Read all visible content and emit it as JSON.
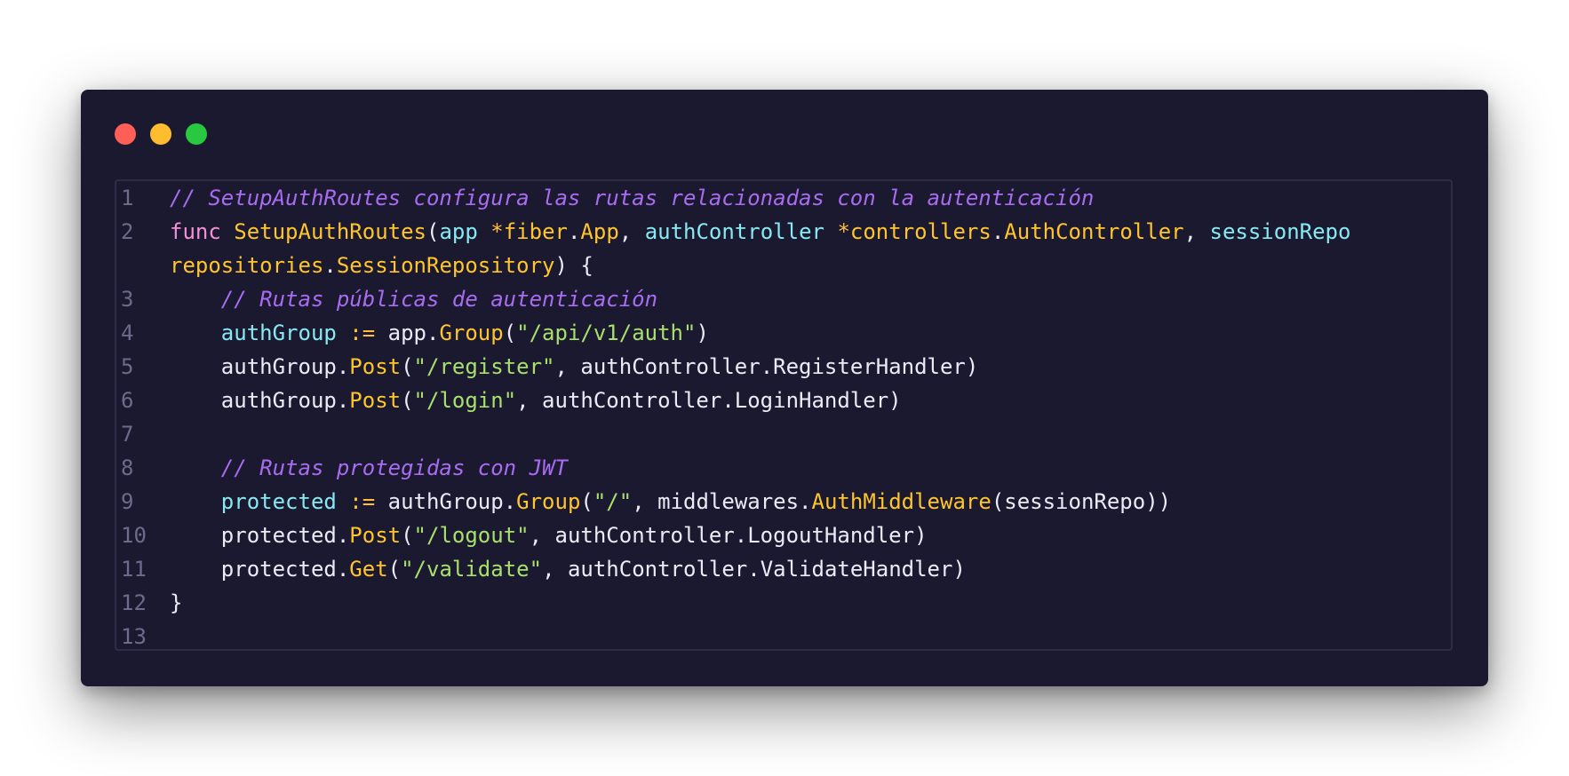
{
  "colors": {
    "window_bg": "#1b1930",
    "comment": "#a86cf0",
    "keyword": "#f48fd8",
    "function": "#ffc52b",
    "variable": "#87eaf2",
    "operator": "#ffbe3c",
    "string": "#a8e06b",
    "text": "#ecebf5",
    "line_number": "#6d6a8c"
  },
  "window_controls": [
    "close",
    "minimize",
    "maximize"
  ],
  "code": {
    "lines": [
      {
        "num": "1",
        "tokens": [
          {
            "t": "cmt",
            "v": "// SetupAuthRoutes configura las rutas relacionadas con la autenticación"
          }
        ]
      },
      {
        "num": "2",
        "tokens": [
          {
            "t": "kw",
            "v": "func"
          },
          {
            "t": "pl",
            "v": " "
          },
          {
            "t": "fn",
            "v": "SetupAuthRoutes"
          },
          {
            "t": "pl",
            "v": "("
          },
          {
            "t": "var",
            "v": "app"
          },
          {
            "t": "pl",
            "v": " "
          },
          {
            "t": "op",
            "v": "*"
          },
          {
            "t": "fn",
            "v": "fiber"
          },
          {
            "t": "pl",
            "v": "."
          },
          {
            "t": "fn",
            "v": "App"
          },
          {
            "t": "pl",
            "v": ", "
          },
          {
            "t": "var",
            "v": "authController"
          },
          {
            "t": "pl",
            "v": " "
          },
          {
            "t": "op",
            "v": "*"
          },
          {
            "t": "fn",
            "v": "controllers"
          },
          {
            "t": "pl",
            "v": "."
          },
          {
            "t": "fn",
            "v": "AuthController"
          },
          {
            "t": "pl",
            "v": ", "
          },
          {
            "t": "var",
            "v": "sessionRepo"
          }
        ]
      },
      {
        "num": "",
        "tokens": [
          {
            "t": "fn",
            "v": "repositories"
          },
          {
            "t": "pl",
            "v": "."
          },
          {
            "t": "fn",
            "v": "SessionRepository"
          },
          {
            "t": "pl",
            "v": ") {"
          }
        ]
      },
      {
        "num": "3",
        "tokens": [
          {
            "t": "pl",
            "v": "    "
          },
          {
            "t": "cmt",
            "v": "// Rutas públicas de autenticación"
          }
        ]
      },
      {
        "num": "4",
        "tokens": [
          {
            "t": "pl",
            "v": "    "
          },
          {
            "t": "var",
            "v": "authGroup"
          },
          {
            "t": "pl",
            "v": " "
          },
          {
            "t": "op",
            "v": ":="
          },
          {
            "t": "pl",
            "v": " app."
          },
          {
            "t": "fn",
            "v": "Group"
          },
          {
            "t": "pl",
            "v": "("
          },
          {
            "t": "str",
            "v": "\"/api/v1/auth\""
          },
          {
            "t": "pl",
            "v": ")"
          }
        ]
      },
      {
        "num": "5",
        "tokens": [
          {
            "t": "pl",
            "v": "    authGroup."
          },
          {
            "t": "fn",
            "v": "Post"
          },
          {
            "t": "pl",
            "v": "("
          },
          {
            "t": "str",
            "v": "\"/register\""
          },
          {
            "t": "pl",
            "v": ", authController.RegisterHandler)"
          }
        ]
      },
      {
        "num": "6",
        "tokens": [
          {
            "t": "pl",
            "v": "    authGroup."
          },
          {
            "t": "fn",
            "v": "Post"
          },
          {
            "t": "pl",
            "v": "("
          },
          {
            "t": "str",
            "v": "\"/login\""
          },
          {
            "t": "pl",
            "v": ", authController.LoginHandler)"
          }
        ]
      },
      {
        "num": "7",
        "tokens": []
      },
      {
        "num": "8",
        "tokens": [
          {
            "t": "pl",
            "v": "    "
          },
          {
            "t": "cmt",
            "v": "// Rutas protegidas con JWT"
          }
        ]
      },
      {
        "num": "9",
        "tokens": [
          {
            "t": "pl",
            "v": "    "
          },
          {
            "t": "var",
            "v": "protected"
          },
          {
            "t": "pl",
            "v": " "
          },
          {
            "t": "op",
            "v": ":="
          },
          {
            "t": "pl",
            "v": " authGroup."
          },
          {
            "t": "fn",
            "v": "Group"
          },
          {
            "t": "pl",
            "v": "("
          },
          {
            "t": "str",
            "v": "\"/\""
          },
          {
            "t": "pl",
            "v": ", middlewares."
          },
          {
            "t": "fn",
            "v": "AuthMiddleware"
          },
          {
            "t": "pl",
            "v": "(sessionRepo))"
          }
        ]
      },
      {
        "num": "10",
        "tokens": [
          {
            "t": "pl",
            "v": "    protected."
          },
          {
            "t": "fn",
            "v": "Post"
          },
          {
            "t": "pl",
            "v": "("
          },
          {
            "t": "str",
            "v": "\"/logout\""
          },
          {
            "t": "pl",
            "v": ", authController.LogoutHandler)"
          }
        ]
      },
      {
        "num": "11",
        "tokens": [
          {
            "t": "pl",
            "v": "    protected."
          },
          {
            "t": "fn",
            "v": "Get"
          },
          {
            "t": "pl",
            "v": "("
          },
          {
            "t": "str",
            "v": "\"/validate\""
          },
          {
            "t": "pl",
            "v": ", authController.ValidateHandler)"
          }
        ]
      },
      {
        "num": "12",
        "tokens": [
          {
            "t": "pl",
            "v": "}"
          }
        ]
      },
      {
        "num": "13",
        "tokens": []
      }
    ]
  }
}
